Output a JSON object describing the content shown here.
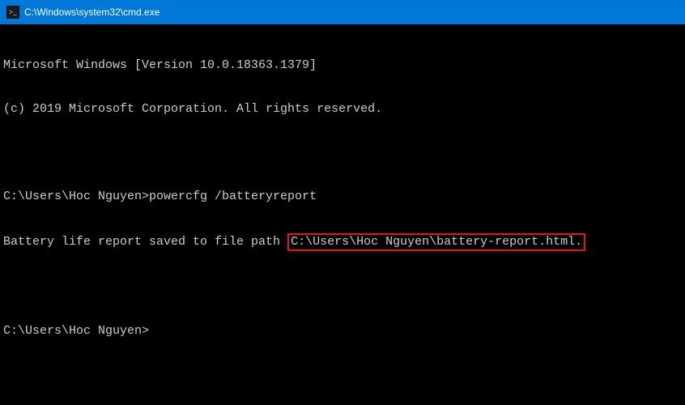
{
  "titlebar": {
    "icon_name": "cmd-icon",
    "title": "C:\\Windows\\system32\\cmd.exe"
  },
  "console": {
    "version_line": "Microsoft Windows [Version 10.0.18363.1379]",
    "copyright_line": "(c) 2019 Microsoft Corporation. All rights reserved.",
    "prompt1_path": "C:\\Users\\Hoc Nguyen>",
    "command": "powercfg /batteryreport",
    "output_prefix": "Battery life report saved to file path ",
    "output_highlighted": "C:\\Users\\Hoc Nguyen\\battery-report.html.",
    "prompt2_path": "C:\\Users\\Hoc Nguyen>"
  }
}
